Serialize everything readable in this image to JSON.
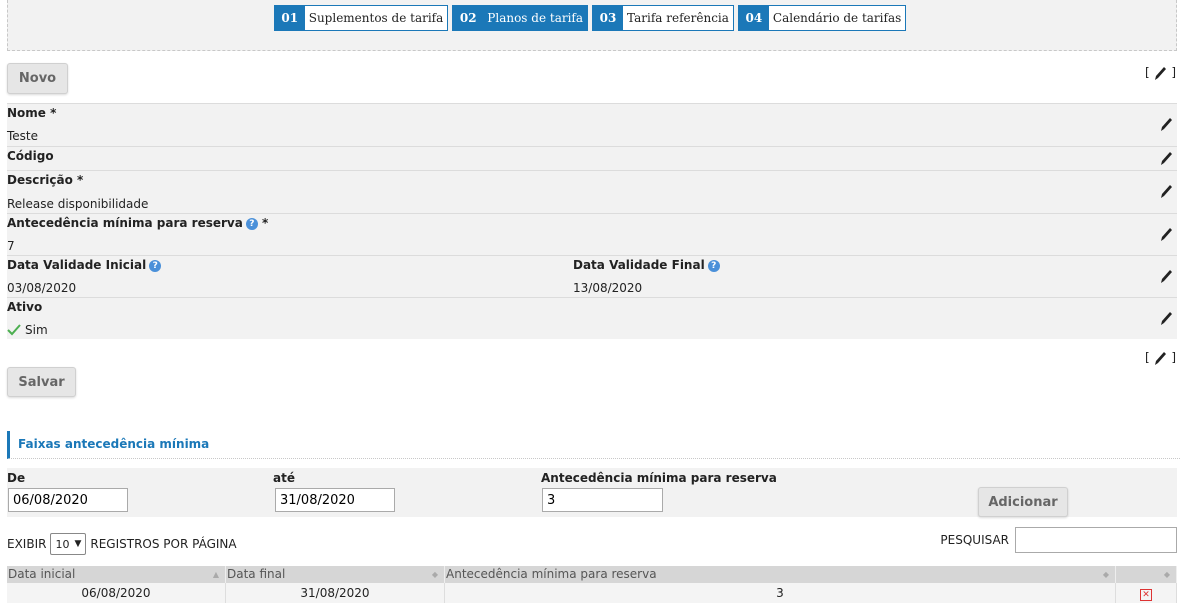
{
  "steps": [
    {
      "num": "01",
      "label": "Suplementos de tarifa",
      "active": false
    },
    {
      "num": "02",
      "label": "Planos de tarifa",
      "active": true
    },
    {
      "num": "03",
      "label": "Tarifa referência",
      "active": false
    },
    {
      "num": "04",
      "label": "Calendário de tarifas",
      "active": false
    }
  ],
  "toolbar": {
    "new_label": "Novo",
    "save_label": "Salvar",
    "bracket_open": "[",
    "bracket_close": "]"
  },
  "form": {
    "nome": {
      "label": "Nome *",
      "value": "Teste"
    },
    "codigo": {
      "label": "Código",
      "value": ""
    },
    "descricao": {
      "label": "Descrição *",
      "value": "Release disponibilidade"
    },
    "antecedencia": {
      "label": "Antecedência mínima para reserva",
      "required": "*",
      "value": "7"
    },
    "data_inicial": {
      "label": "Data Validade Inicial",
      "value": "03/08/2020"
    },
    "data_final": {
      "label": "Data Validade Final",
      "value": "13/08/2020"
    },
    "ativo": {
      "label": "Ativo",
      "value": "Sim"
    }
  },
  "section": {
    "title": "Faixas antecedência mínima"
  },
  "add_form": {
    "de_label": "De",
    "de_value": "06/08/2020",
    "ate_label": "até",
    "ate_value": "31/08/2020",
    "antec_label": "Antecedência mínima para reserva",
    "antec_value": "3",
    "add_label": "Adicionar"
  },
  "table_tools": {
    "show_label": "EXIBIR",
    "page_size": "10",
    "per_page_label": "REGISTROS POR PÁGINA",
    "search_label": "PESQUISAR"
  },
  "table": {
    "columns": [
      "Data inicial",
      "Data final",
      "Antecedência mínima para reserva",
      ""
    ],
    "rows": [
      [
        "06/08/2020",
        "31/08/2020",
        "3"
      ]
    ]
  },
  "colors": {
    "accent": "#1b78b8",
    "row_bg": "#f2f2f2",
    "check": "#4caf50",
    "delete": "#dd3333"
  }
}
